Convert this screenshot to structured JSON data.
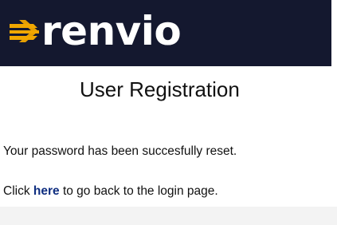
{
  "header": {
    "brand_name": "renvio",
    "background_color": "#14182f",
    "accent_color": "#f0a700",
    "logo_icon": "sunburst-arrows-icon"
  },
  "main": {
    "title": "User Registration",
    "message": "Your password has been succesfully reset.",
    "login_prompt": {
      "prefix": "Click ",
      "link_text": "here",
      "suffix": " to go back to the login page."
    },
    "link_color": "#0f2e80"
  }
}
